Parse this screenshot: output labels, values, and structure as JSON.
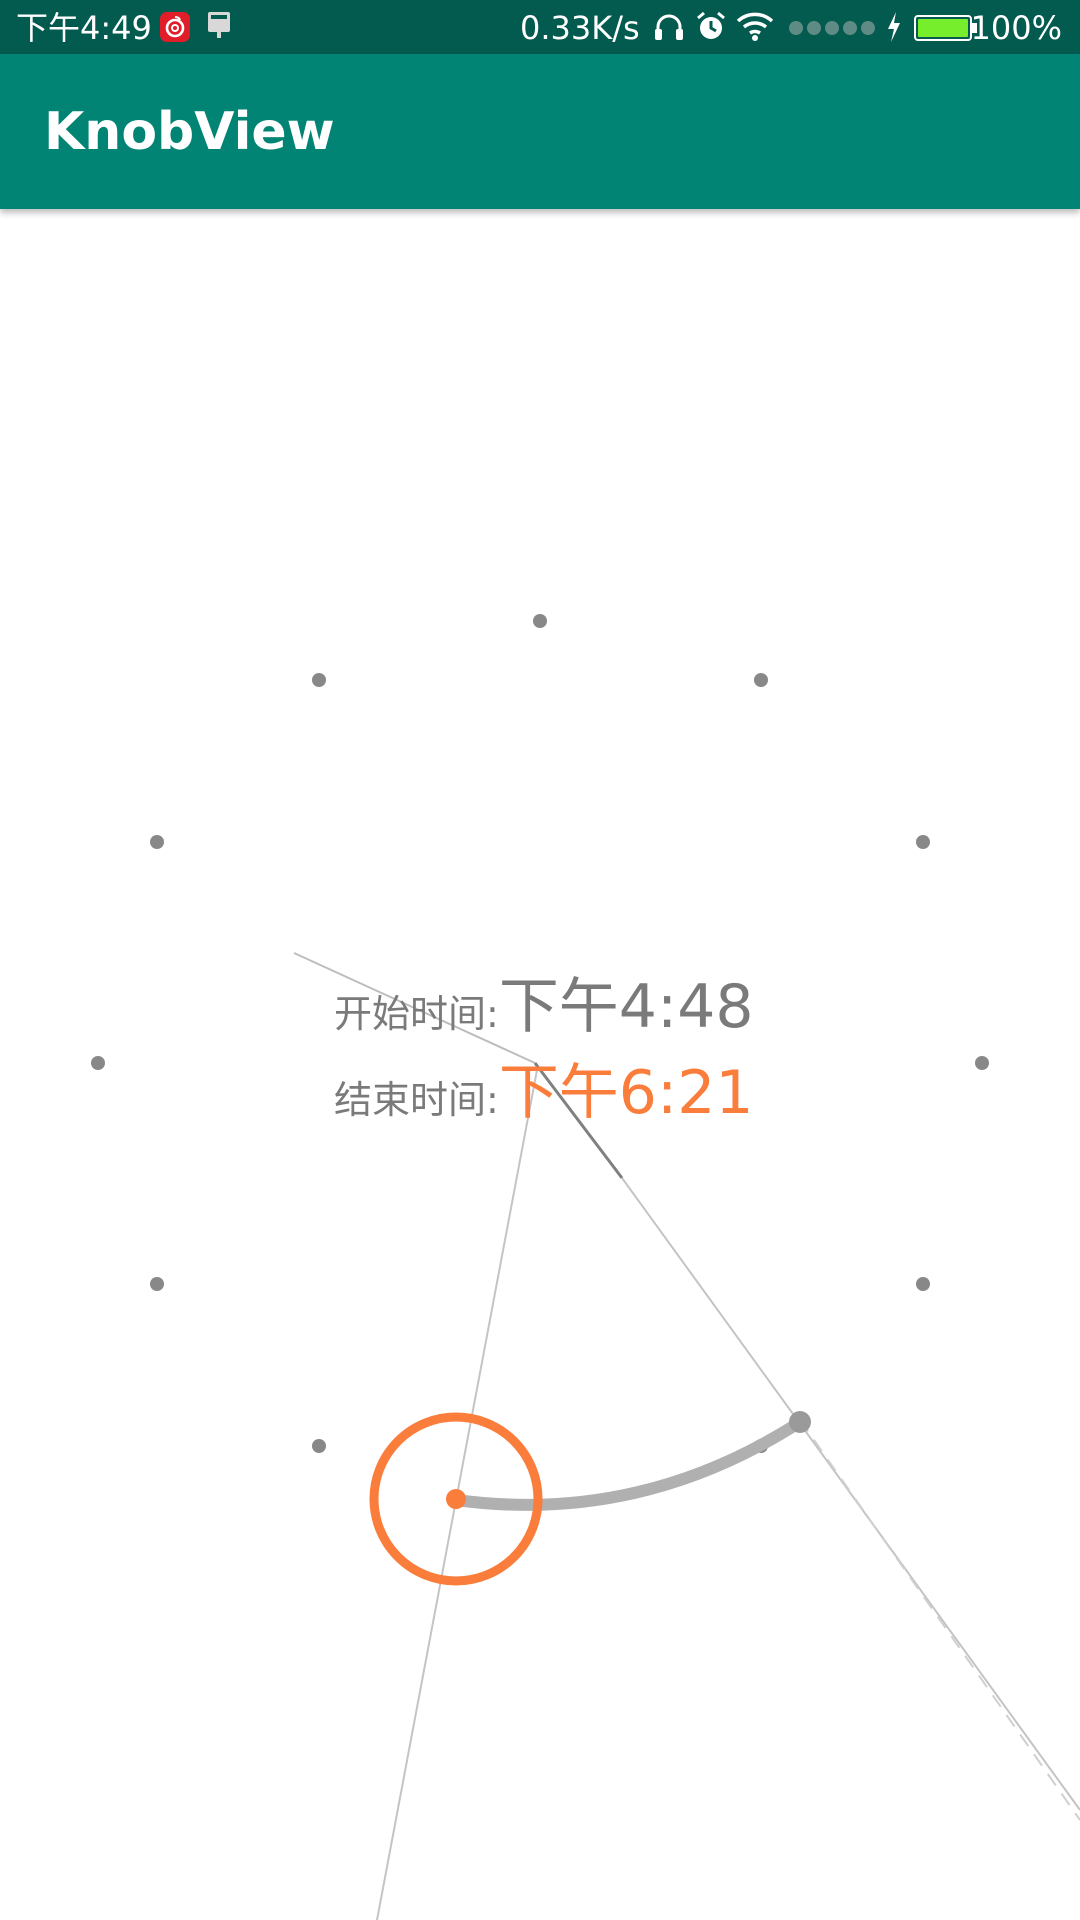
{
  "status_bar": {
    "time": "下午4:49",
    "net_speed": "0.33K/s",
    "battery_percent": "100%",
    "icons": [
      "netease-music-icon",
      "notification-icon",
      "headphones-icon",
      "alarm-icon",
      "wifi-icon",
      "signal-icon",
      "charging-icon",
      "battery-icon"
    ],
    "colors": {
      "background": "#035a4f",
      "battery_fill": "#76ee2b",
      "music_badge": "#e01e2a"
    }
  },
  "app_bar": {
    "title": "KnobView",
    "color": "#028475"
  },
  "knob": {
    "start_label": "开始时间:",
    "start_value": "下午4:48",
    "end_label": "结束时间:",
    "end_value": "下午6:21",
    "colors": {
      "accent": "#fa7d3c",
      "label": "#7a7a7a",
      "dot": "#808080",
      "arc": "#b0b0b0",
      "guide_line": "#c8c8c8"
    },
    "tick_count": 12
  }
}
